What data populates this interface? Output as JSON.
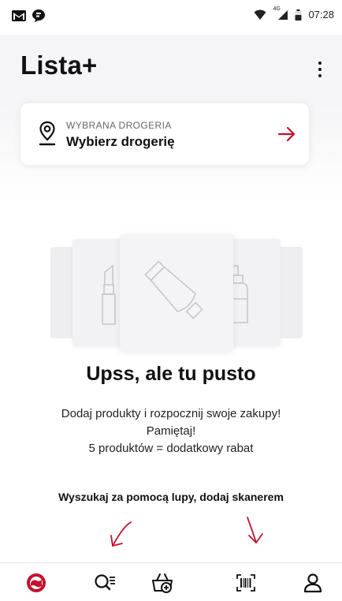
{
  "status_bar": {
    "network": "4G",
    "time": "07:28"
  },
  "header": {
    "title": "Lista+",
    "more_icon": "more-vertical-icon"
  },
  "store_selector": {
    "caption": "WYBRANA DROGERIA",
    "value": "Wybierz drogerię",
    "icon": "location-pin-icon",
    "action_icon": "arrow-right-icon"
  },
  "empty_state": {
    "title": "Upss, ale tu pusto",
    "line1": "Dodaj produkty i rozpocznij swoje zakupy!",
    "line2": "Pamiętaj!",
    "line3": "5 produktów = dodatkowy rabat",
    "hint": "Wyszukaj za pomocą lupy, dodaj skanerem"
  },
  "bottom_nav": {
    "items": [
      {
        "icon": "brand-logo-icon",
        "active": true
      },
      {
        "icon": "search-list-icon",
        "active": false
      },
      {
        "icon": "basket-add-icon",
        "active": false
      },
      {
        "icon": "barcode-scanner-icon",
        "active": false
      },
      {
        "icon": "profile-icon",
        "active": false
      }
    ]
  },
  "colors": {
    "accent": "#c8102e",
    "header_bg": "#f5f5f7",
    "text": "#111111"
  }
}
